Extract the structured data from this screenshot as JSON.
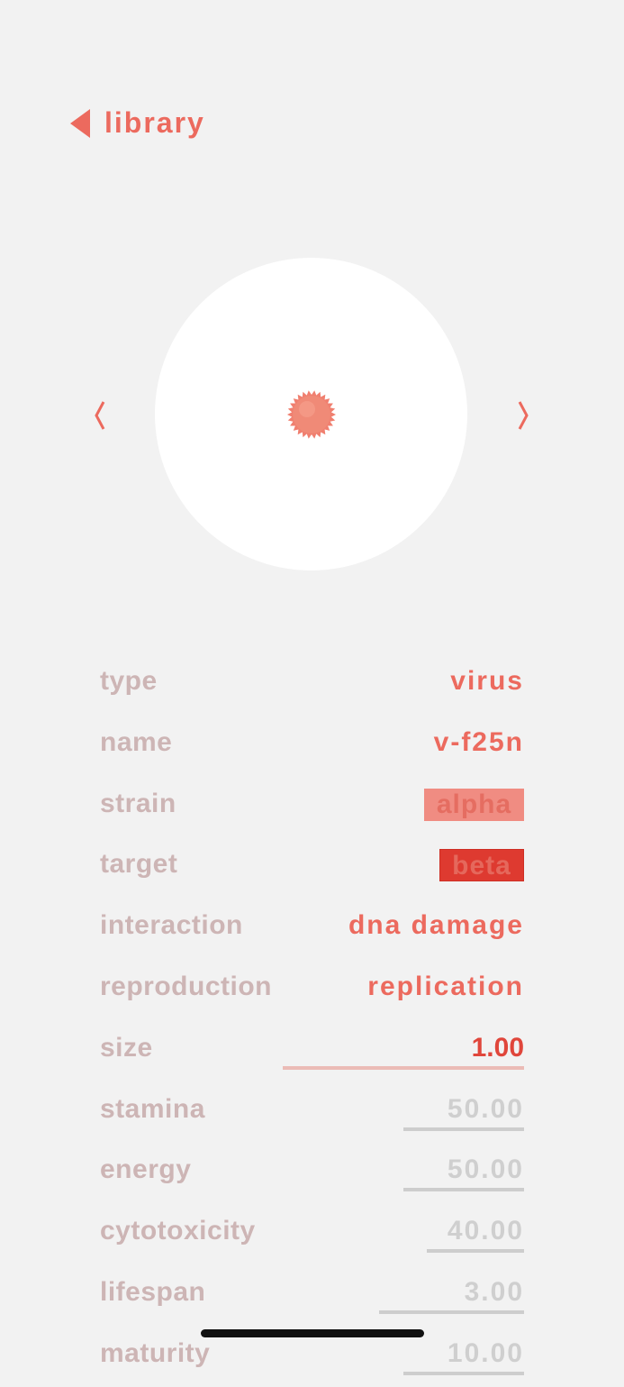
{
  "header": {
    "back_label": "library",
    "back_icon": "back-triangle-icon"
  },
  "viewer": {
    "prev_icon": "chevron-left-icon",
    "next_icon": "chevron-right-icon",
    "specimen_icon": "virus-icon"
  },
  "properties": [
    {
      "label": "type",
      "value": "virus"
    },
    {
      "label": "name",
      "value": "v-f25n"
    },
    {
      "label": "strain",
      "value": "alpha"
    },
    {
      "label": "target",
      "value": "beta"
    },
    {
      "label": "interaction",
      "value": "dna damage"
    },
    {
      "label": "reproduction",
      "value": "replication"
    },
    {
      "label": "size",
      "value": "1.00"
    },
    {
      "label": "stamina",
      "value": "50.00"
    },
    {
      "label": "energy",
      "value": "50.00"
    },
    {
      "label": "cytotoxicity",
      "value": "40.00"
    },
    {
      "label": "lifespan",
      "value": "3.00"
    },
    {
      "label": "maturity",
      "value": "10.00"
    }
  ],
  "colors": {
    "accent": "#ec6a5e",
    "label": "#cdb5b5",
    "strain_chip": "#f08c82",
    "target_chip": "#de3a30",
    "viewer_bg": "#ffffff",
    "page_bg": "#f2f2f2"
  }
}
